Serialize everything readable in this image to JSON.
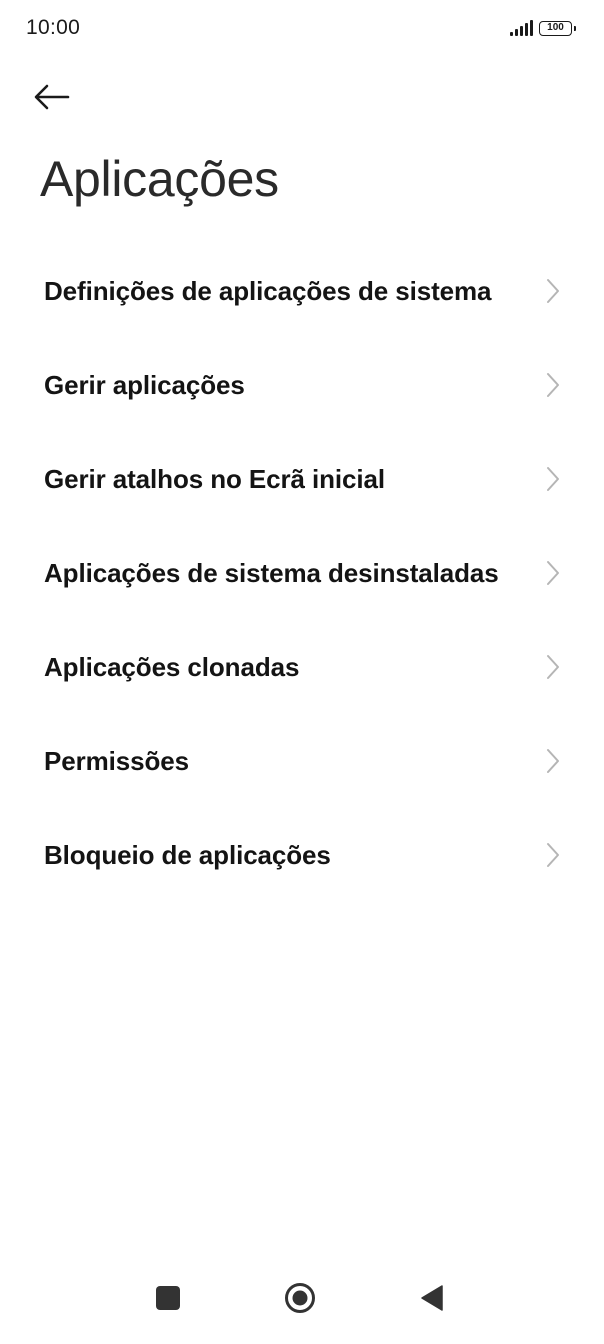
{
  "status_bar": {
    "time": "10:00",
    "battery_level": "100",
    "icons": [
      "signal-icon",
      "battery-icon"
    ]
  },
  "header": {
    "back_icon": "arrow-left-icon",
    "title": "Aplicações"
  },
  "menu": {
    "items": [
      {
        "label": "Definições de aplicações de sistema",
        "icon": "chevron-right-icon"
      },
      {
        "label": "Gerir aplicações",
        "icon": "chevron-right-icon"
      },
      {
        "label": "Gerir atalhos no Ecrã inicial",
        "icon": "chevron-right-icon"
      },
      {
        "label": "Aplicações de sistema desinstaladas",
        "icon": "chevron-right-icon"
      },
      {
        "label": "Aplicações clonadas",
        "icon": "chevron-right-icon"
      },
      {
        "label": "Permissões",
        "icon": "chevron-right-icon"
      },
      {
        "label": "Bloqueio de aplicações",
        "icon": "chevron-right-icon"
      }
    ]
  },
  "nav_bar": {
    "icons": [
      "recents-square-icon",
      "home-circle-icon",
      "back-triangle-icon"
    ]
  },
  "colors": {
    "background": "#ffffff",
    "text_primary": "#141414",
    "title": "#2a2a2a",
    "chevron": "#b5b5b5",
    "nav_icon": "#333333"
  }
}
